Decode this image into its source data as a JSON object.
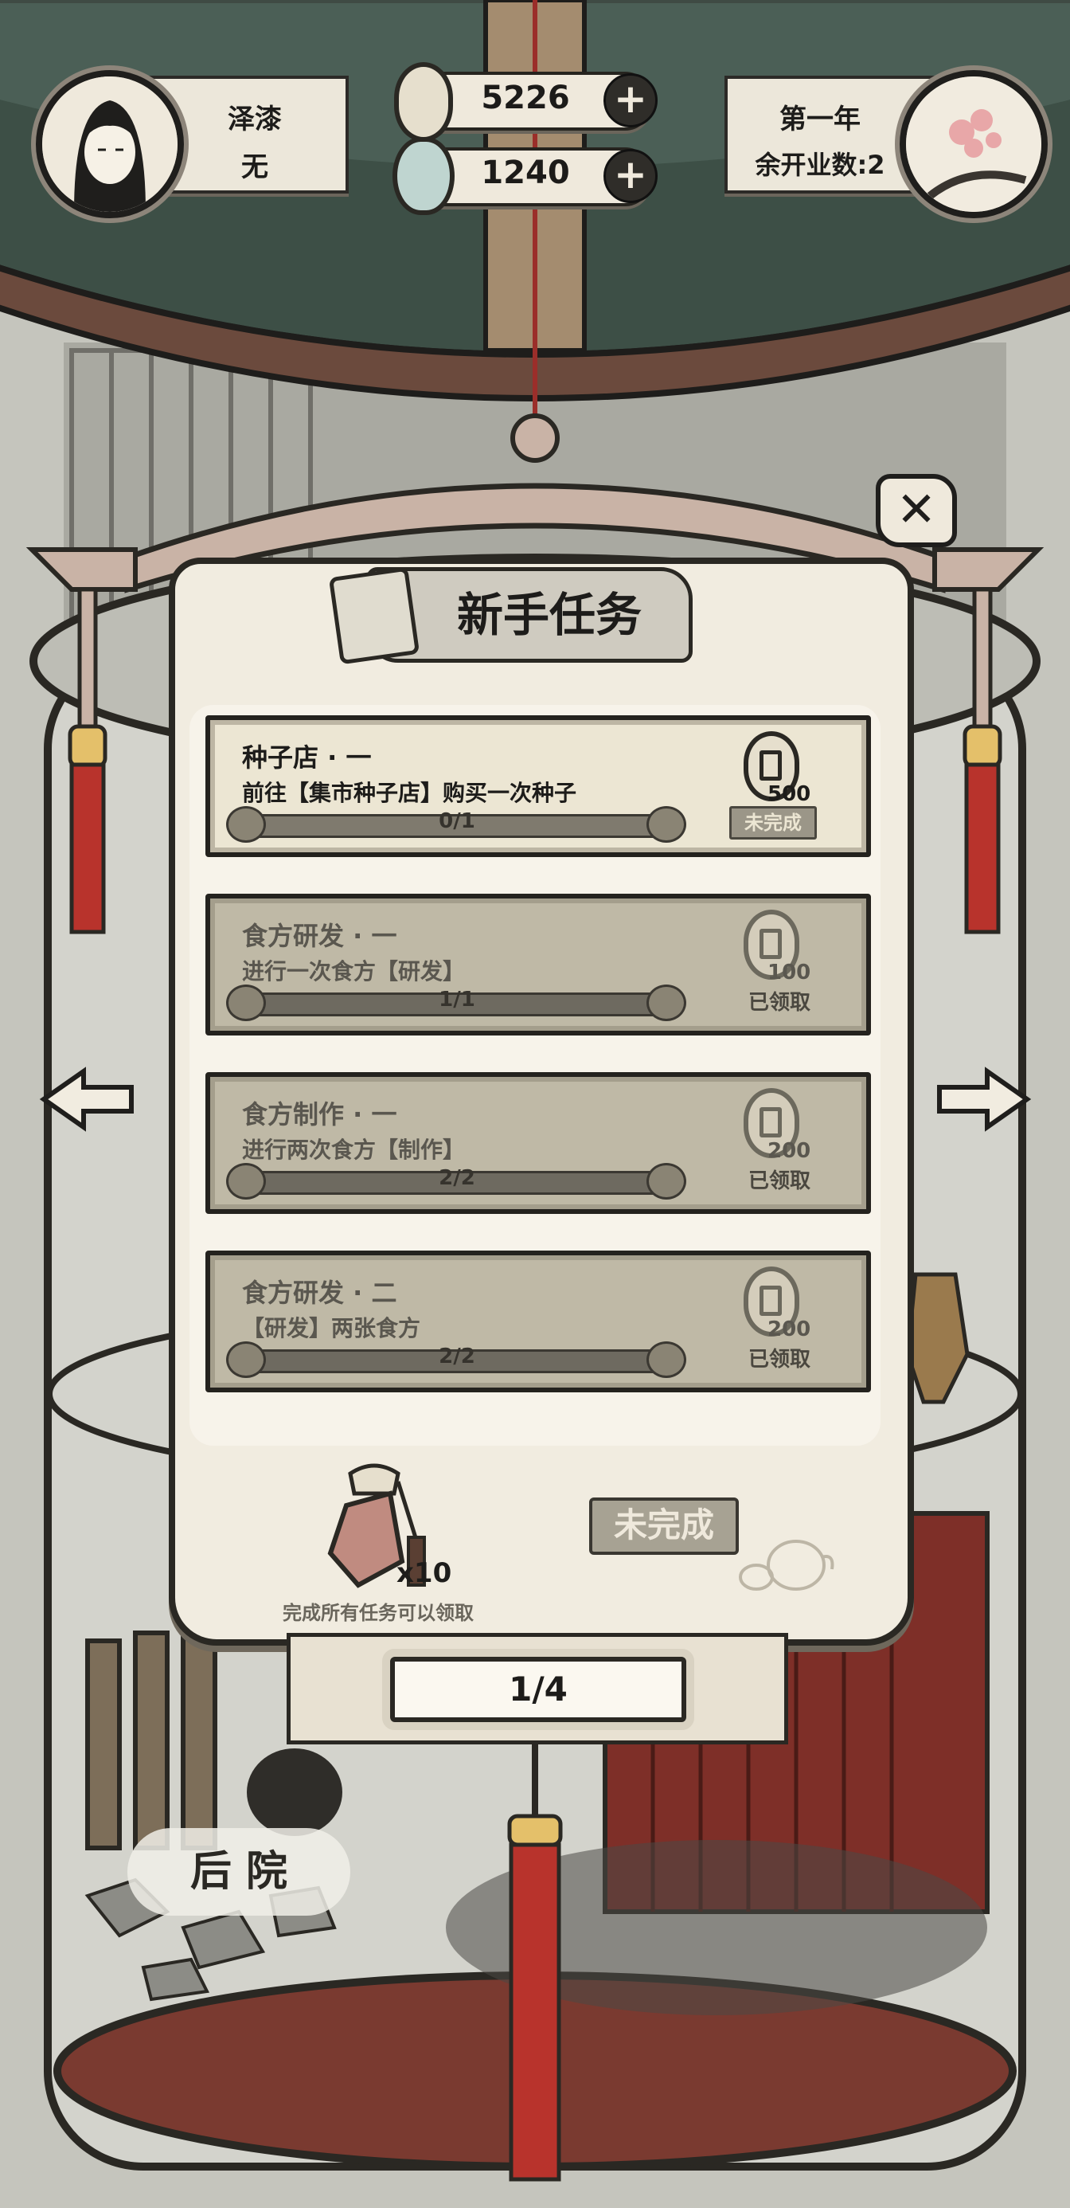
{
  "player": {
    "name": "泽漆",
    "title": "无"
  },
  "currency": {
    "coins": "5226",
    "jade": "1240"
  },
  "calendar": {
    "year": "第一年",
    "remaining_openings": "余开业数:2"
  },
  "panel": {
    "title": "新手任务",
    "tasks": [
      {
        "title": "种子店 · 一",
        "desc": "前往【集市种子店】购买一次种子",
        "progress": "0/1",
        "progress_fraction": 0.0,
        "reward": "500",
        "status": "未完成",
        "done": false
      },
      {
        "title": "食方研发 · 一",
        "desc": "进行一次食方【研发】",
        "progress": "1/1",
        "progress_fraction": 1.0,
        "reward": "100",
        "status": "已领取",
        "done": true
      },
      {
        "title": "食方制作 · 一",
        "desc": "进行两次食方【制作】",
        "progress": "2/2",
        "progress_fraction": 1.0,
        "reward": "200",
        "status": "已领取",
        "done": true
      },
      {
        "title": "食方研发 · 二",
        "desc": "【研发】两张食方",
        "progress": "2/2",
        "progress_fraction": 1.0,
        "reward": "200",
        "status": "已领取",
        "done": true
      }
    ],
    "final_reward": {
      "count": "x10",
      "hint": "完成所有任务可以领取"
    },
    "final_status": "未完成",
    "page": "1/4"
  },
  "location": {
    "label": "后 院"
  },
  "colors": {
    "ink": "#2a2823",
    "paper": "#f1ece0",
    "tassel": "#b8332c",
    "roof": "#3d4f46"
  }
}
